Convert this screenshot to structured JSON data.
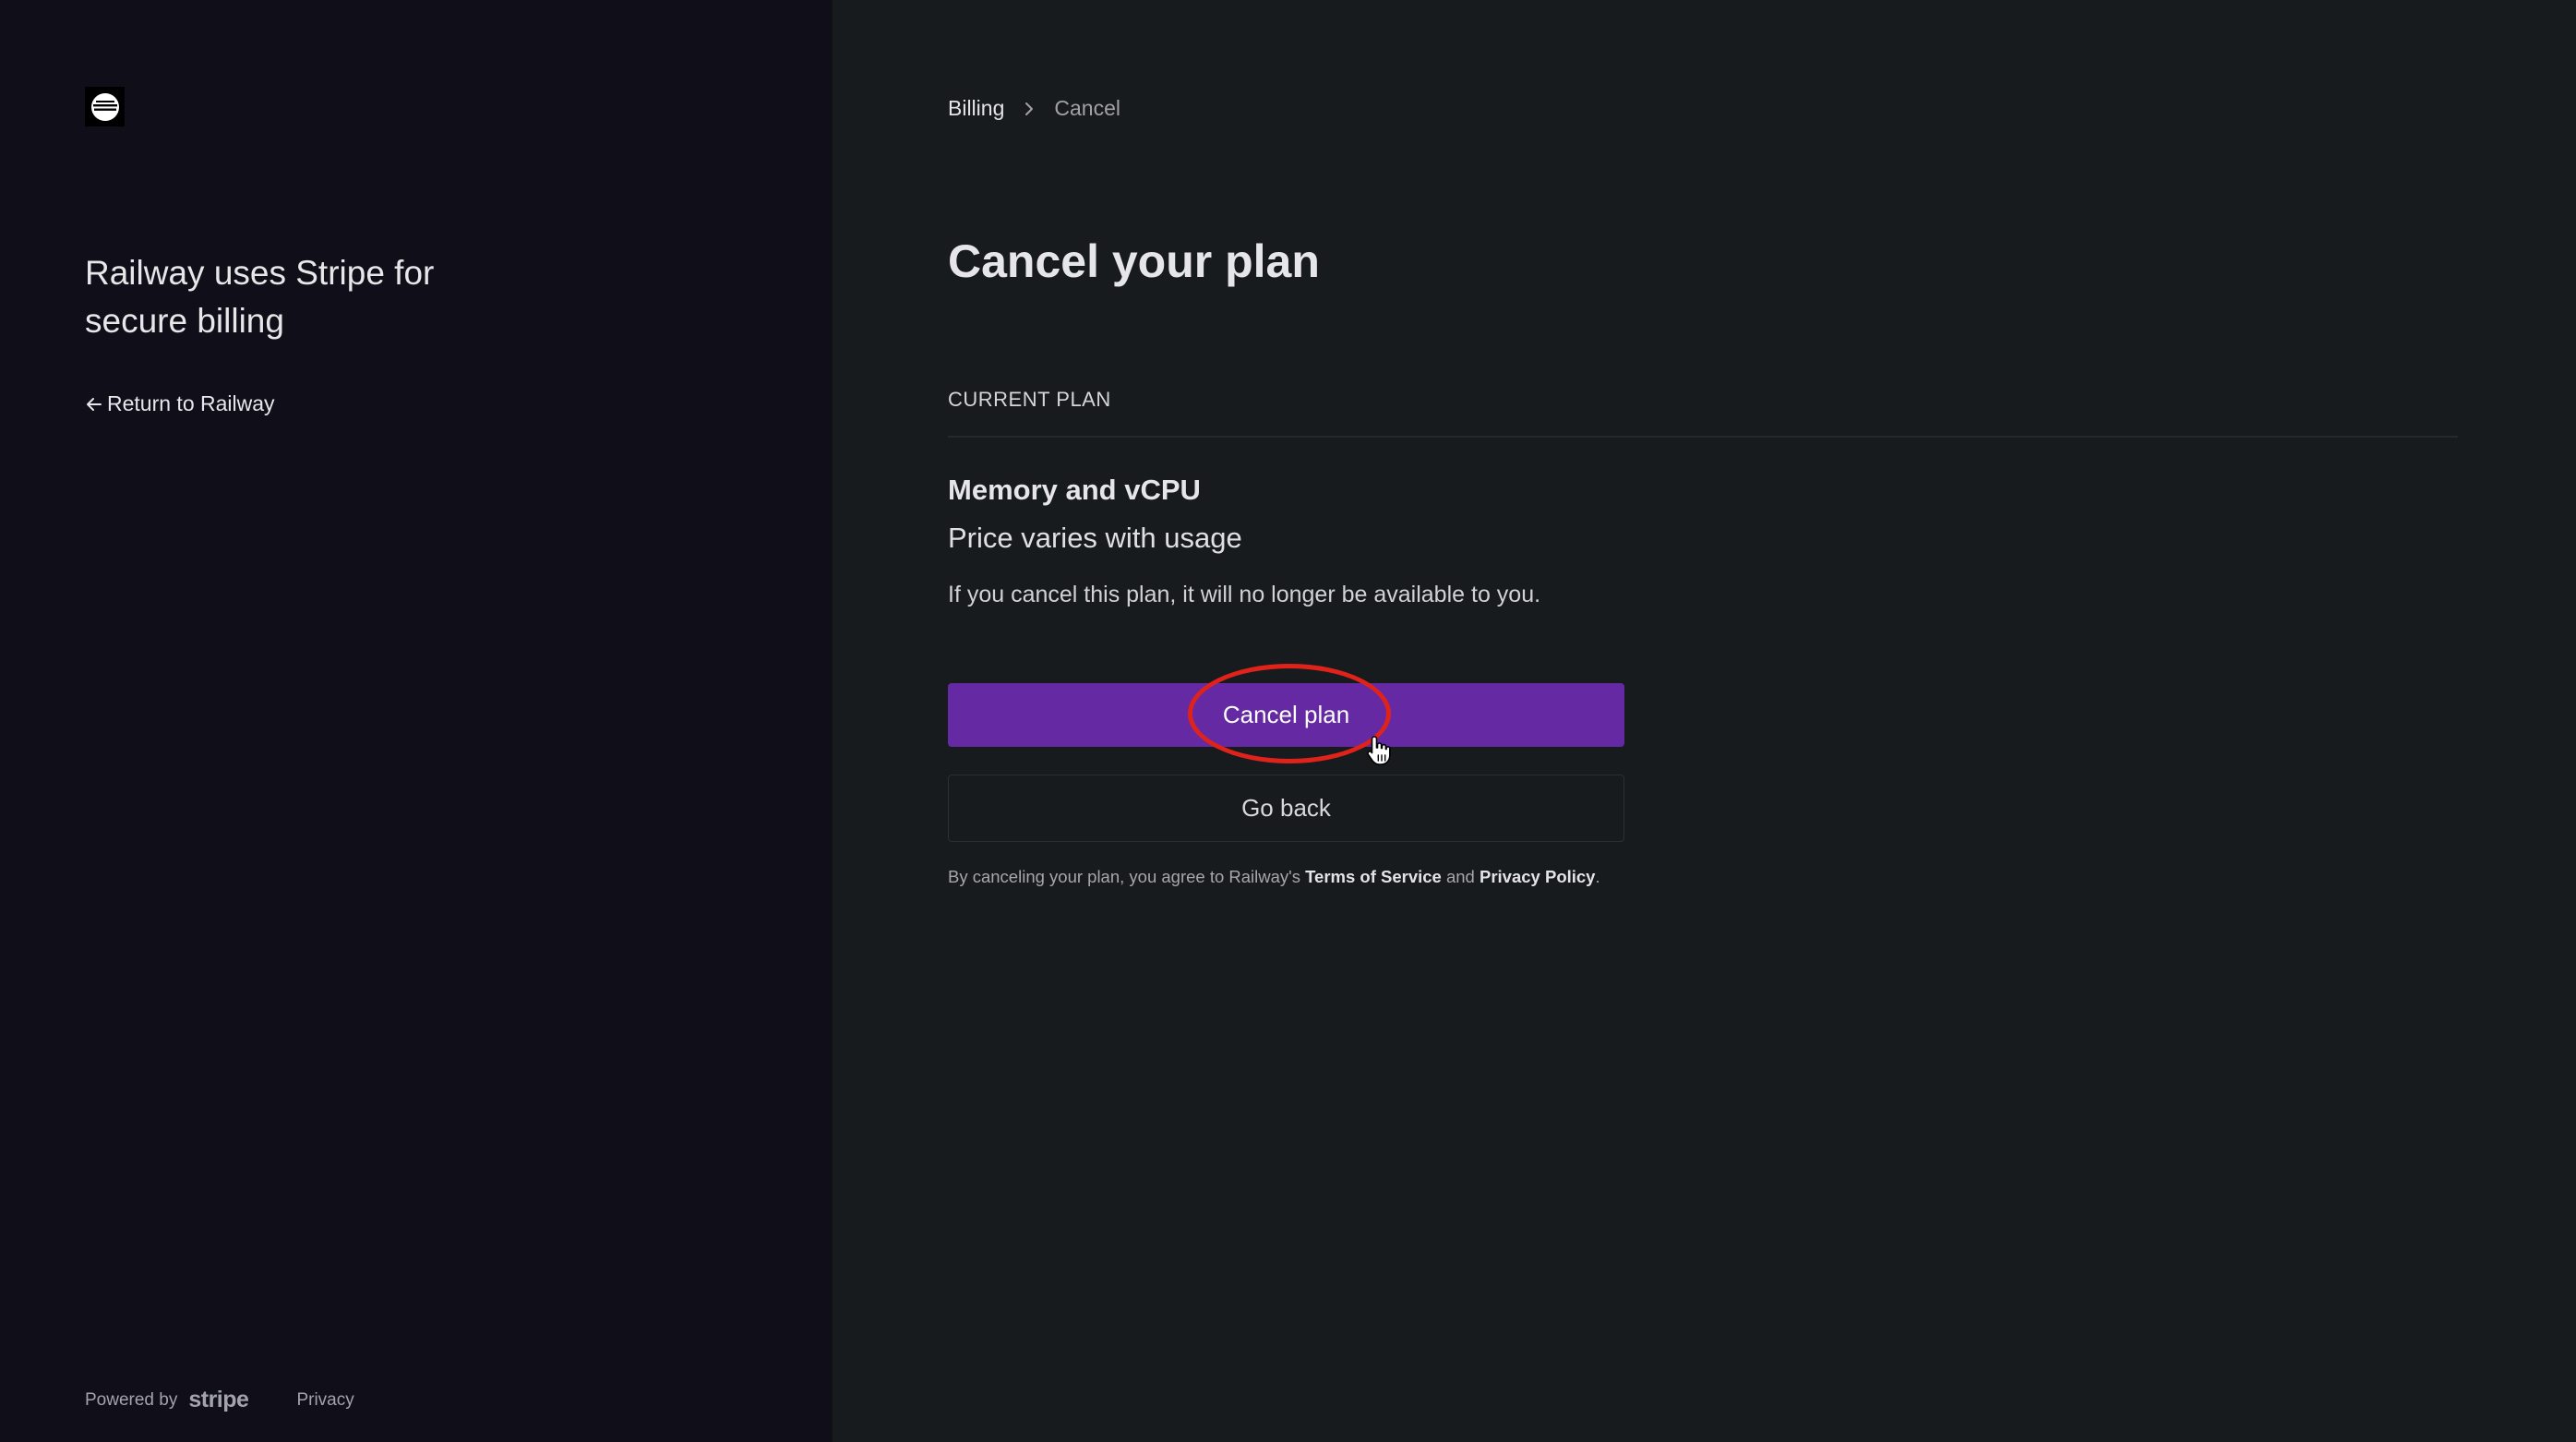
{
  "sidebar": {
    "logo_icon": "railway-logo-icon",
    "tagline": "Railway uses Stripe for secure billing",
    "return_link": "Return to Railway",
    "footer": {
      "powered_by": "Powered by",
      "brand": "stripe",
      "privacy": "Privacy"
    }
  },
  "breadcrumb": {
    "parent": "Billing",
    "current": "Cancel"
  },
  "main": {
    "title": "Cancel your plan",
    "section_label": "CURRENT PLAN",
    "plan": {
      "name": "Memory and vCPU",
      "price": "Price varies with usage",
      "note": "If you cancel this plan, it will no longer be available to you."
    },
    "buttons": {
      "cancel": "Cancel plan",
      "back": "Go back"
    },
    "legal": {
      "prefix": "By canceling your plan, you agree to Railway's ",
      "terms": "Terms of Service",
      "and": " and ",
      "privacy": "Privacy Policy",
      "suffix": "."
    }
  },
  "colors": {
    "left_panel_bg": "#0f0e19",
    "right_panel_bg": "#181b1e",
    "primary_button": "#652aa3",
    "annotation": "#e0231a"
  }
}
